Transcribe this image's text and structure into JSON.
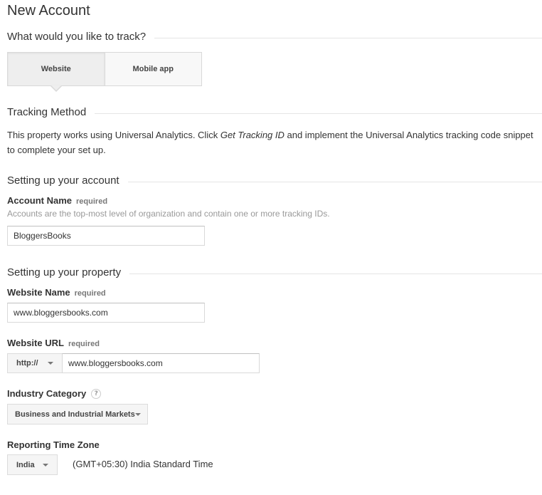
{
  "page": {
    "title": "New Account"
  },
  "track": {
    "heading": "What would you like to track?",
    "options": [
      {
        "label": "Website",
        "selected": true
      },
      {
        "label": "Mobile app",
        "selected": false
      }
    ]
  },
  "tracking_method": {
    "heading": "Tracking Method",
    "text_before": "This property works using Universal Analytics. Click ",
    "text_link": "Get Tracking ID",
    "text_after": " and implement the Universal Analytics tracking code snippet to complete your set up."
  },
  "account": {
    "heading": "Setting up your account",
    "name_label": "Account Name",
    "required_label": "required",
    "hint": "Accounts are the top-most level of organization and contain one or more tracking IDs.",
    "name_value": "BloggersBooks"
  },
  "property": {
    "heading": "Setting up your property",
    "website_name_label": "Website Name",
    "website_name_required": "required",
    "website_name_value": "www.bloggersbooks.com",
    "website_url_label": "Website URL",
    "website_url_required": "required",
    "protocol_value": "http://",
    "website_url_value": "www.bloggersbooks.com",
    "industry_label": "Industry Category",
    "help_icon_glyph": "?",
    "industry_value": "Business and Industrial Markets",
    "timezone_label": "Reporting Time Zone",
    "country_value": "India",
    "timezone_value": "(GMT+05:30) India Standard Time"
  },
  "colors": {
    "rule": "#e5e5e5",
    "hint": "#999999",
    "border": "#d9d9d9"
  },
  "icons": {
    "dropdown": "chevron-down-icon",
    "help": "help-icon"
  }
}
